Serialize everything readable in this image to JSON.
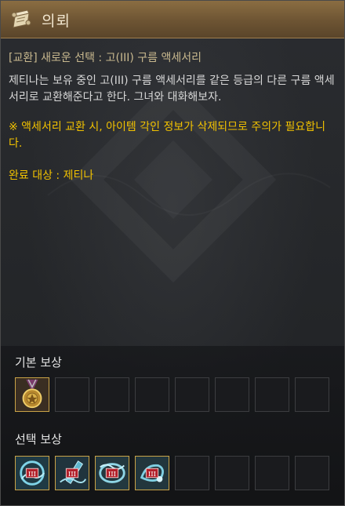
{
  "window": {
    "title": "의뢰"
  },
  "quest": {
    "subtitle": "[교환] 새로운 선택 : 고(III) 구름 액세서리",
    "description": "제티나는 보유 중인 고(III) 구름 액세서리를 같은 등급의 다른 구름 액세서리로 교환해준다고 한다. 그녀와 대화해보자.",
    "warning": "※ 액세서리 교환 시, 아이템 각인 정보가 삭제되므로 주의가 필요합니다.",
    "completion_target": "완료 대상 : 제티나"
  },
  "rewards": {
    "basic_label": "기본 보상",
    "choice_label": "선택 보상",
    "basic_slots": [
      "medal-icon",
      "",
      "",
      "",
      "",
      "",
      "",
      ""
    ],
    "choice_slots": [
      "cloud-accessory-icon",
      "cloud-accessory-icon",
      "cloud-accessory-icon",
      "cloud-accessory-icon",
      "",
      "",
      "",
      ""
    ],
    "grade_badge": "III"
  },
  "colors": {
    "title_bar": "#6d5433",
    "warning_text": "#f2c200",
    "subtitle_text": "#c9b98f",
    "slot_border_filled": "#c9a347"
  }
}
